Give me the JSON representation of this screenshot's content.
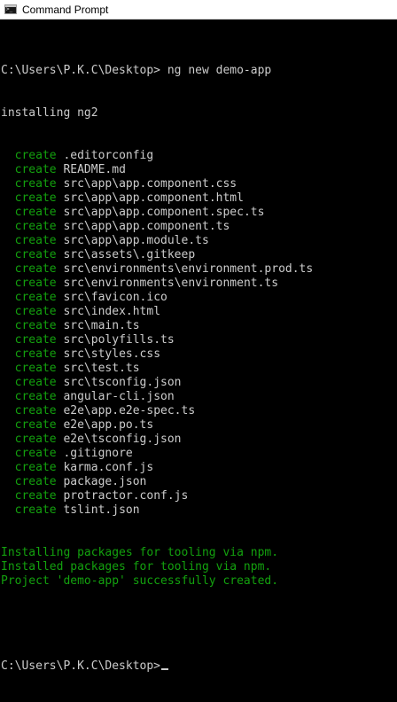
{
  "window": {
    "title": "Command Prompt",
    "icon": "command-prompt-icon"
  },
  "terminal": {
    "prompt": "C:\\Users\\P.K.C\\Desktop>",
    "command": " ng new demo-app",
    "installing": "installing ng2",
    "create_keyword": "create",
    "files": [
      ".editorconfig",
      "README.md",
      "src\\app\\app.component.css",
      "src\\app\\app.component.html",
      "src\\app\\app.component.spec.ts",
      "src\\app\\app.component.ts",
      "src\\app\\app.module.ts",
      "src\\assets\\.gitkeep",
      "src\\environments\\environment.prod.ts",
      "src\\environments\\environment.ts",
      "src\\favicon.ico",
      "src\\index.html",
      "src\\main.ts",
      "src\\polyfills.ts",
      "src\\styles.css",
      "src\\test.ts",
      "src\\tsconfig.json",
      "angular-cli.json",
      "e2e\\app.e2e-spec.ts",
      "e2e\\app.po.ts",
      "e2e\\tsconfig.json",
      ".gitignore",
      "karma.conf.js",
      "package.json",
      "protractor.conf.js",
      "tslint.json"
    ],
    "status_lines": [
      "Installing packages for tooling via npm.",
      "Installed packages for tooling via npm.",
      "Project 'demo-app' successfully created."
    ],
    "final_prompt": "C:\\Users\\P.K.C\\Desktop>"
  },
  "colors": {
    "background": "#000000",
    "text": "#cccccc",
    "green": "#13a10e"
  }
}
